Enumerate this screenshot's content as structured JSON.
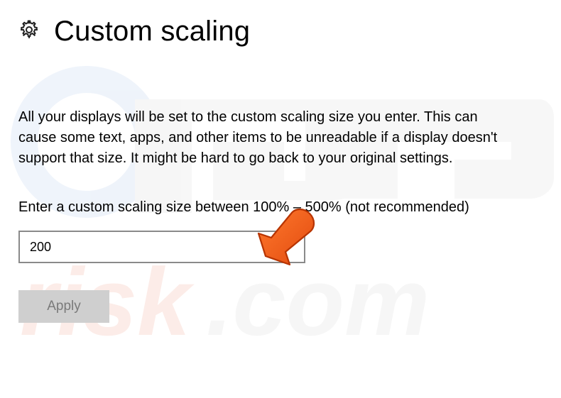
{
  "header": {
    "title": "Custom scaling"
  },
  "body": {
    "description": "All your displays will be set to the custom scaling size you enter. This can cause some text, apps, and other items to be unreadable if a display doesn't support that size. It might be hard to go back to your original settings.",
    "prompt": "Enter a custom scaling size between 100% – 500% (not recommended)",
    "input_value": "200"
  },
  "actions": {
    "apply_label": "Apply"
  }
}
